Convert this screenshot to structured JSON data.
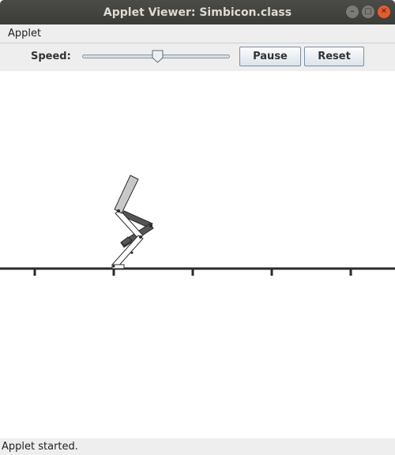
{
  "window": {
    "title": "Applet Viewer: Simbicon.class",
    "buttons": [
      "minimize",
      "maximize",
      "close"
    ]
  },
  "menubar": {
    "items": [
      {
        "label": "Applet"
      }
    ]
  },
  "toolbar": {
    "speed_label": "Speed:",
    "speed_value": 0.51,
    "pause_label": "Pause",
    "reset_label": "Reset"
  },
  "status": {
    "text": "Applet started."
  },
  "colors": {
    "title_bg": "#3e3e3b",
    "title_text": "#dfdbd2",
    "close_button": "#e65b2d",
    "panel_bg": "#eeeeee",
    "ground": "#2a2a2a",
    "torso": "#c8c8c8",
    "dark_leg": "#555555",
    "light_leg": "#ffffff"
  },
  "icons": {
    "minimize": "minus-icon",
    "maximize": "square-icon",
    "close": "x-icon"
  }
}
